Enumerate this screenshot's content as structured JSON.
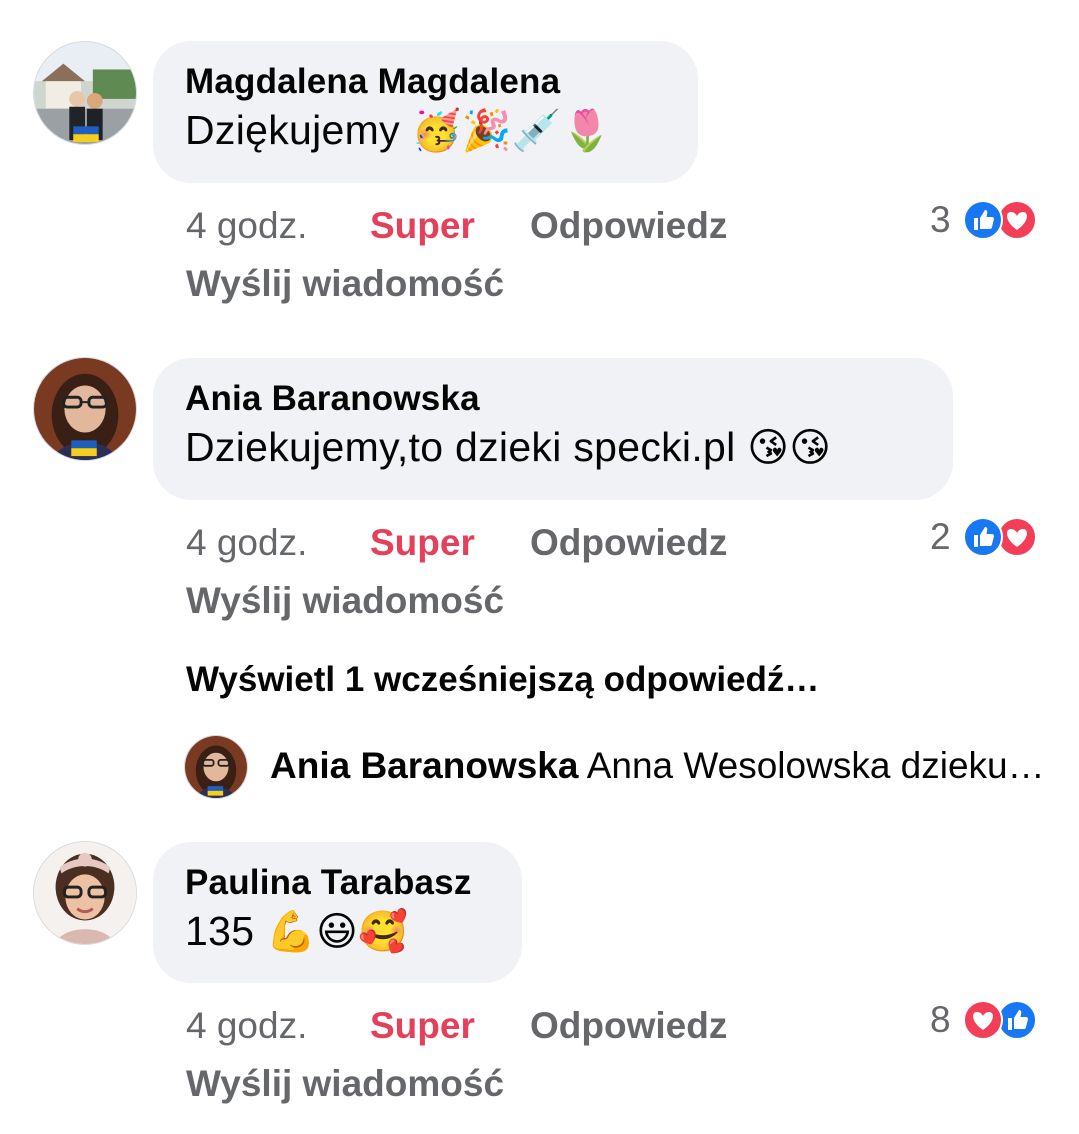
{
  "comments": [
    {
      "author": "Magdalena Magdalena",
      "text": "Dziękujemy",
      "emojis": "🥳🎉💉🌷",
      "time": "4 godz.",
      "super_label": "Super",
      "reply_label": "Odpowiedz",
      "message_label": "Wyślij wiadomość",
      "reaction_count": "3",
      "reaction_icons": [
        "like-icon",
        "love-icon"
      ]
    },
    {
      "author": "Ania Baranowska",
      "text": "Dziekujemy,to dzieki specki.pl",
      "emojis": "😘😘",
      "time": "4 godz.",
      "super_label": "Super",
      "reply_label": "Odpowiedz",
      "message_label": "Wyślij wiadomość",
      "reaction_count": "2",
      "reaction_icons": [
        "like-icon",
        "love-icon"
      ]
    },
    {
      "author": "Paulina Tarabasz",
      "text": "135",
      "emojis": "💪😃🥰",
      "time": "4 godz.",
      "super_label": "Super",
      "reply_label": "Odpowiedz",
      "message_label": "Wyślij wiadomość",
      "reaction_count": "8",
      "reaction_icons": [
        "love-icon",
        "like-icon"
      ]
    }
  ],
  "view_previous": "Wyświetl 1 wcześniejszą odpowiedź…",
  "reply_preview": {
    "author": "Ania Baranowska",
    "text": "Anna Wesolowska dzieku…"
  },
  "colors": {
    "bubble": "#f0f2f5",
    "super": "#e4405b",
    "secondary_text": "#65676b",
    "like_blue": "#1877f2",
    "love_red": "#f33e58"
  }
}
